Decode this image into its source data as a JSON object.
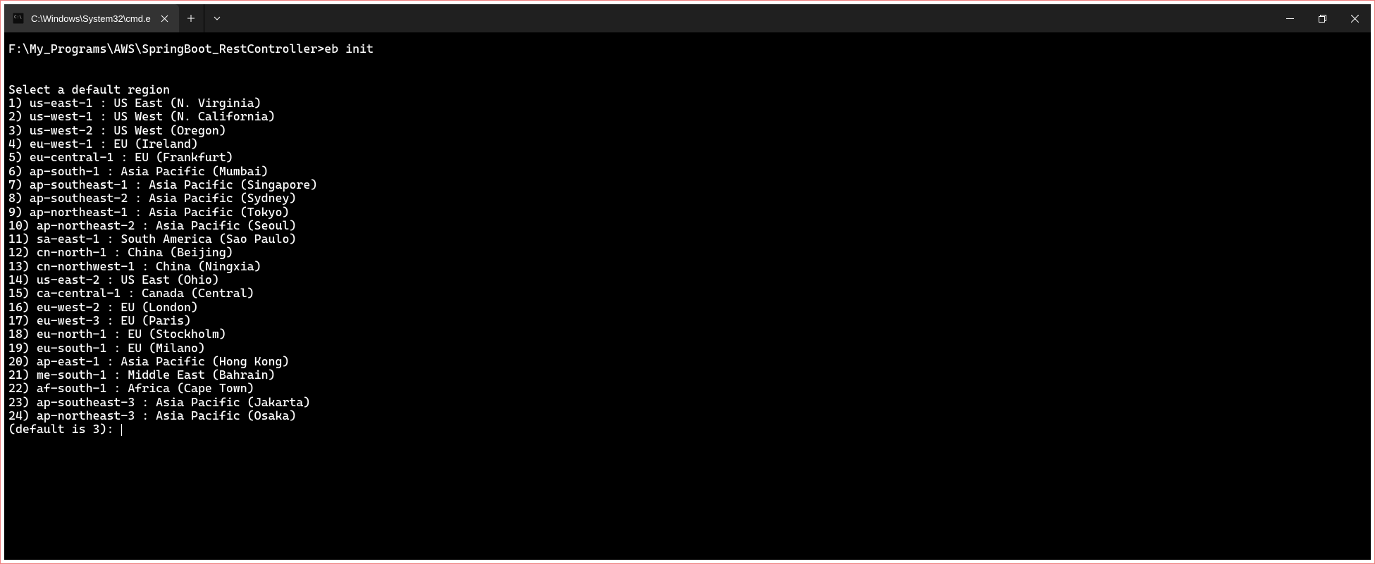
{
  "window": {
    "tab_title": "C:\\Windows\\System32\\cmd.e"
  },
  "terminal": {
    "prompt": "F:\\My_Programs\\AWS\\SpringBoot_RestController>",
    "command": "eb init",
    "heading": "Select a default region",
    "regions": [
      "1) us-east-1 : US East (N. Virginia)",
      "2) us-west-1 : US West (N. California)",
      "3) us-west-2 : US West (Oregon)",
      "4) eu-west-1 : EU (Ireland)",
      "5) eu-central-1 : EU (Frankfurt)",
      "6) ap-south-1 : Asia Pacific (Mumbai)",
      "7) ap-southeast-1 : Asia Pacific (Singapore)",
      "8) ap-southeast-2 : Asia Pacific (Sydney)",
      "9) ap-northeast-1 : Asia Pacific (Tokyo)",
      "10) ap-northeast-2 : Asia Pacific (Seoul)",
      "11) sa-east-1 : South America (Sao Paulo)",
      "12) cn-north-1 : China (Beijing)",
      "13) cn-northwest-1 : China (Ningxia)",
      "14) us-east-2 : US East (Ohio)",
      "15) ca-central-1 : Canada (Central)",
      "16) eu-west-2 : EU (London)",
      "17) eu-west-3 : EU (Paris)",
      "18) eu-north-1 : EU (Stockholm)",
      "19) eu-south-1 : EU (Milano)",
      "20) ap-east-1 : Asia Pacific (Hong Kong)",
      "21) me-south-1 : Middle East (Bahrain)",
      "22) af-south-1 : Africa (Cape Town)",
      "23) ap-southeast-3 : Asia Pacific (Jakarta)",
      "24) ap-northeast-3 : Asia Pacific (Osaka)"
    ],
    "input_prompt": "(default is 3): "
  }
}
